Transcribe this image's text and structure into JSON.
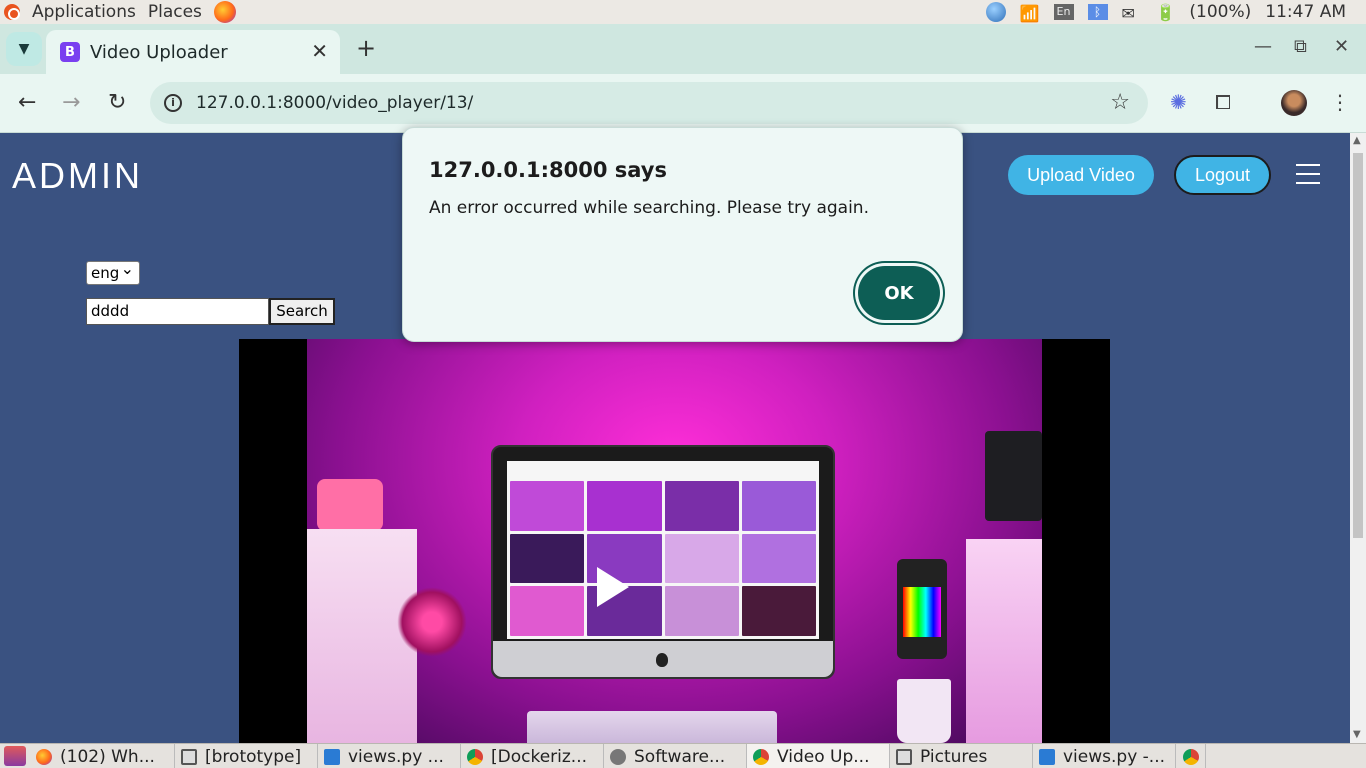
{
  "system_panel": {
    "applications": "Applications",
    "places": "Places",
    "keyboard_layout": "En",
    "battery": "(100%)",
    "clock": "11:47 AM"
  },
  "browser": {
    "tab_title": "Video Uploader",
    "tab_favicon": "B",
    "url": "127.0.0.1:8000/video_player/13/"
  },
  "page": {
    "logo": "ADMIN",
    "upload_button": "Upload Video",
    "logout_button": "Logout",
    "language_selected": "eng",
    "search_value": "dddd",
    "search_button": "Search"
  },
  "dialog": {
    "title": "127.0.0.1:8000 says",
    "message": "An error occurred while searching. Please try again.",
    "ok_button": "OK"
  },
  "taskbar": {
    "items": [
      {
        "label": "(102) Wh...",
        "icon": "firefox-icon"
      },
      {
        "label": "[brototype]",
        "icon": "window-icon"
      },
      {
        "label": "views.py ...",
        "icon": "vscode-icon"
      },
      {
        "label": "[Dockeriz...",
        "icon": "chrome-icon"
      },
      {
        "label": "Software...",
        "icon": "software-icon"
      },
      {
        "label": "Video Up...",
        "icon": "chrome-icon"
      },
      {
        "label": "Pictures",
        "icon": "window-icon"
      },
      {
        "label": "views.py -...",
        "icon": "vscode-icon"
      }
    ]
  },
  "colors": {
    "page_background": "#3a5281",
    "accent_button": "#40b4e5",
    "dialog_ok": "#0d5e55"
  }
}
